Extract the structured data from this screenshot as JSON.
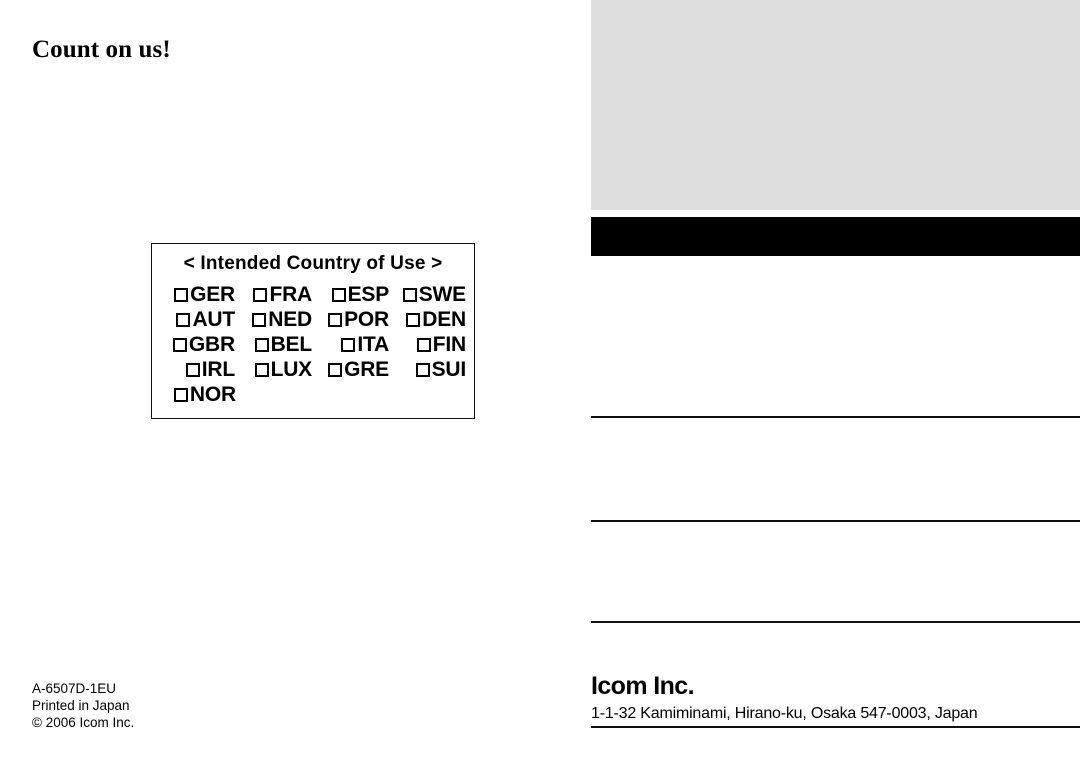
{
  "left_page": {
    "tagline": "Count on us!",
    "country_box": {
      "title": "< Intended Country of Use >",
      "rows": [
        [
          "GER",
          "FRA",
          "ESP",
          "SWE"
        ],
        [
          "AUT",
          "NED",
          "POR",
          "DEN"
        ],
        [
          "GBR",
          "BEL",
          "ITA",
          "FIN"
        ],
        [
          "IRL",
          "LUX",
          "GRE",
          "SUI"
        ],
        [
          "NOR",
          "",
          "",
          ""
        ]
      ]
    },
    "imprint": {
      "doc_number": "A-6507D-1EU",
      "printed_in": "Printed in Japan",
      "copyright": "© 2006 Icom Inc."
    }
  },
  "right_page": {
    "company_name": "Icom Inc.",
    "address": "1-1-32 Kamiminami, Hirano-ku, Osaka 547-0003, Japan"
  },
  "colors": {
    "gray_block": "#dedede",
    "black_bar": "#000000",
    "rule": "#111111",
    "page_background": "#ffffff"
  }
}
